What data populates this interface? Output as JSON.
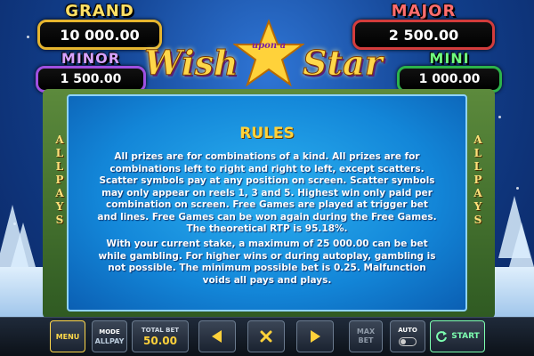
{
  "jackpots": {
    "grand": {
      "label": "GRAND",
      "value": "10 000.00"
    },
    "major": {
      "label": "MAJOR",
      "value": "2 500.00"
    },
    "minor": {
      "label": "MINOR",
      "value": "1 500.00"
    },
    "mini": {
      "label": "MINI",
      "value": "1 000.00"
    }
  },
  "logo": {
    "word1": "Wish",
    "word2": "upon a",
    "word3": "Star"
  },
  "side_label": [
    "A",
    "L",
    "L",
    "P",
    "A",
    "Y",
    "S"
  ],
  "rules": {
    "title": "RULES",
    "paragraph1": "All prizes are for combinations of a kind. All prizes are for combinations left to right and right to left, except scatters. Scatter symbols pay at any position on screen. Scatter symbols may only appear on reels 1, 3 and 5. Highest win only paid per combination on screen. Free Games are played at trigger bet and lines. Free Games can be won again during the Free Games. The theoretical RTP is 95.18%.",
    "paragraph2": "With your current stake, a maximum of 25 000.00 can be bet while gambling. For higher wins or during autoplay, gambling is not possible. The minimum possible bet is 0.25. Malfunction voids all pays and plays."
  },
  "controls": {
    "menu": "MENU",
    "mode_label": "MODE",
    "mode_value": "ALLPAY",
    "total_bet_label": "TOTAL BET",
    "total_bet_value": "50.00",
    "max_bet": "MAX BET",
    "auto": "AUTO",
    "start": "START"
  },
  "colors": {
    "panel": "#1386d8",
    "title": "#ffd23a",
    "grand": "#ffe066",
    "major": "#ff6d6d",
    "minor": "#d7a3ff",
    "mini": "#6fff80"
  }
}
